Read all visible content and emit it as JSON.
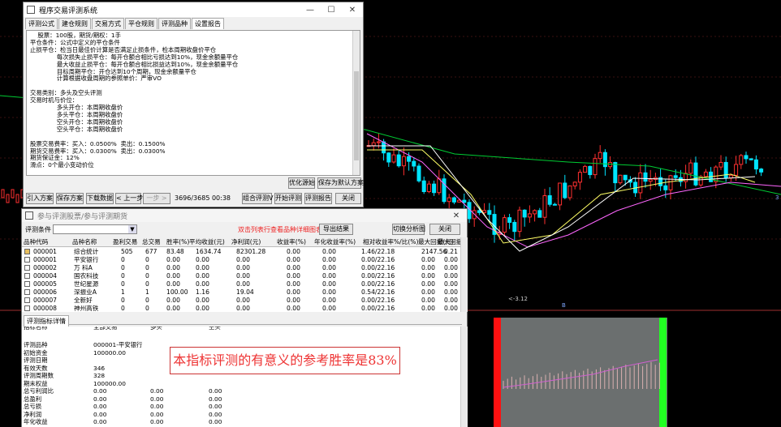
{
  "chart": {
    "low_price_label": "<-3.12",
    "bottom_marker": "B",
    "colors": {
      "up": "#ff3030",
      "down": "#00e5ff",
      "ma1": "#ffffff",
      "ma2": "#ffff66",
      "ma3": "#ff66ff",
      "ma4": "#00cc33"
    }
  },
  "eval_window": {
    "title": "程序交易评测系统",
    "tabs": [
      "评测公式",
      "建仓规则",
      "交易方式",
      "平仓规则",
      "评测品种",
      "设置报告"
    ],
    "active_tab": 5,
    "report_lines": [
      "    股票：100股，期货/期权：1手",
      "平仓条件：公式中定义的平仓条件",
      "止损平仓：检当日最佳价计算是否满足止损条件，检本周期收盘价平仓",
      "              每次损失止损平仓：每开仓额合相比亏损达到10%，现金余额量平仓",
      "              最大收益止损平仓：每开仓额合相比损益达到10%，现金余额量平仓",
      "              目标周期平仓：开仓达到10个周期，现金余额量平仓",
      "              计算根据收盘周期的参照单价：严审VO",
      "",
      "交易类别：多头及空头评测",
      "交易时机与价位：",
      "              多头开仓：本周期收盘价",
      "              多头平仓：本周期收盘价",
      "              空头开仓：本周期收盘价",
      "              空头平仓：本周期收盘价",
      "",
      "股票交易费率：买入：0.0500%  卖出：0.1500%",
      "期货交易费率：买入：0.0300%  卖出：0.0300%",
      "期货保证金：12%",
      "滑点：0个最小变动价位"
    ],
    "btn_strategy": "优化源始",
    "btn_save_default": "保存为默认方案",
    "btn_import": "引入方案",
    "btn_save": "保存方案",
    "btn_download": "下载数据",
    "btn_prev": "< 上一步",
    "btn_next": "一步 >",
    "progress_text": "3696/3685 00:38",
    "btn_combined": "组合评测V",
    "btn_start": "开始评测",
    "btn_report": "评测报告",
    "btn_close": "关闭"
  },
  "list_window": {
    "title": "参与评测股票/参与评测期货",
    "filter_label": "评测条件",
    "filter_value": "",
    "hint": "双击列表行查看品种详细图表",
    "btn_export": "导出结果",
    "btn_chart_analysis": "切换分析图",
    "btn_close": "关闭",
    "columns": [
      "品种代码",
      "品种名称",
      "盈利交易",
      "总交易",
      "胜率(%)",
      "平均收益(元)",
      "净利润(元)",
      "收益率(%)",
      "年化收益率(%)",
      "相对收益率%/比(%)",
      "最大回撤(元)",
      "最大回撤比(%)"
    ],
    "rows": [
      {
        "code": "000001",
        "name": "综合统计",
        "win": "505",
        "total": "677",
        "rate": "83.48",
        "avg": "1634.74",
        "net": "82301.28",
        "ret": "0.00",
        "ann": "0.00",
        "rel": "1.46/22.18",
        "mdd": "2147.56",
        "mddp": "0.21",
        "sel": true
      },
      {
        "code": "000001",
        "name": "平安银行",
        "win": "0",
        "total": "0",
        "rate": "0.00",
        "avg": "0.00",
        "net": "0.00",
        "ret": "0.00",
        "ann": "0.00",
        "rel": "0.00/22.16",
        "mdd": "0.00",
        "mddp": "0.00",
        "sel": false
      },
      {
        "code": "000002",
        "name": "万 科A",
        "win": "0",
        "total": "0",
        "rate": "0.00",
        "avg": "0.00",
        "net": "0.00",
        "ret": "0.00",
        "ann": "0.00",
        "rel": "0.00/22.16",
        "mdd": "0.00",
        "mddp": "0.00",
        "sel": false
      },
      {
        "code": "000004",
        "name": "国农科技",
        "win": "0",
        "total": "0",
        "rate": "0.00",
        "avg": "0.00",
        "net": "0.00",
        "ret": "0.00",
        "ann": "0.00",
        "rel": "0.00/22.16",
        "mdd": "0.00",
        "mddp": "0.00",
        "sel": false
      },
      {
        "code": "000005",
        "name": "世纪星源",
        "win": "0",
        "total": "0",
        "rate": "0.00",
        "avg": "0.00",
        "net": "0.00",
        "ret": "0.00",
        "ann": "0.00",
        "rel": "0.00/22.16",
        "mdd": "0.00",
        "mddp": "0.00",
        "sel": false
      },
      {
        "code": "000006",
        "name": "深振业A",
        "win": "1",
        "total": "1",
        "rate": "100.00",
        "avg": "1.16",
        "net": "19.04",
        "ret": "0.00",
        "ann": "0.00",
        "rel": "0.54/22.16",
        "mdd": "0.00",
        "mddp": "0.00",
        "sel": false
      },
      {
        "code": "000007",
        "name": "全新好",
        "win": "0",
        "total": "0",
        "rate": "0.00",
        "avg": "0.00",
        "net": "0.00",
        "ret": "0.00",
        "ann": "0.00",
        "rel": "0.00/22.16",
        "mdd": "0.00",
        "mddp": "0.00",
        "sel": false
      },
      {
        "code": "000008",
        "name": "神州高铁",
        "win": "0",
        "total": "0",
        "rate": "0.00",
        "avg": "0.00",
        "net": "0.00",
        "ret": "0.00",
        "ann": "0.00",
        "rel": "0.00/22.16",
        "mdd": "0.00",
        "mddp": "0.00",
        "sel": false
      }
    ],
    "details_tab": "评测指标详情",
    "detail_headers": [
      "指标名称",
      "全部交易",
      "多头",
      "空头"
    ],
    "details": [
      {
        "name": "评测品种",
        "all": "000001-平安银行",
        "long": "",
        "short": ""
      },
      {
        "name": "初始资金",
        "all": "100000.00",
        "long": "",
        "short": ""
      },
      {
        "name": "评测日期",
        "all": "",
        "long": "",
        "short": ""
      },
      {
        "name": "有效天数",
        "all": "346",
        "long": "",
        "short": ""
      },
      {
        "name": "评测周期数",
        "all": "328",
        "long": "",
        "short": ""
      },
      {
        "name": "期末权益",
        "all": "100000.00",
        "long": "",
        "short": ""
      },
      {
        "name": "总亏利润比",
        "all": "0.00",
        "long": "0.00",
        "short": "0.00"
      },
      {
        "name": "总盈利",
        "all": "0.00",
        "long": "0.00",
        "short": "0.00"
      },
      {
        "name": "总亏损",
        "all": "0.00",
        "long": "0.00",
        "short": "0.00"
      },
      {
        "name": "净利润",
        "all": "0.00",
        "long": "0.00",
        "short": "0.00"
      },
      {
        "name": "年化收益",
        "all": "0.00",
        "long": "0.00",
        "short": "0.00"
      }
    ],
    "banner": "本指标评测的有意义的参考胜率是83%"
  }
}
